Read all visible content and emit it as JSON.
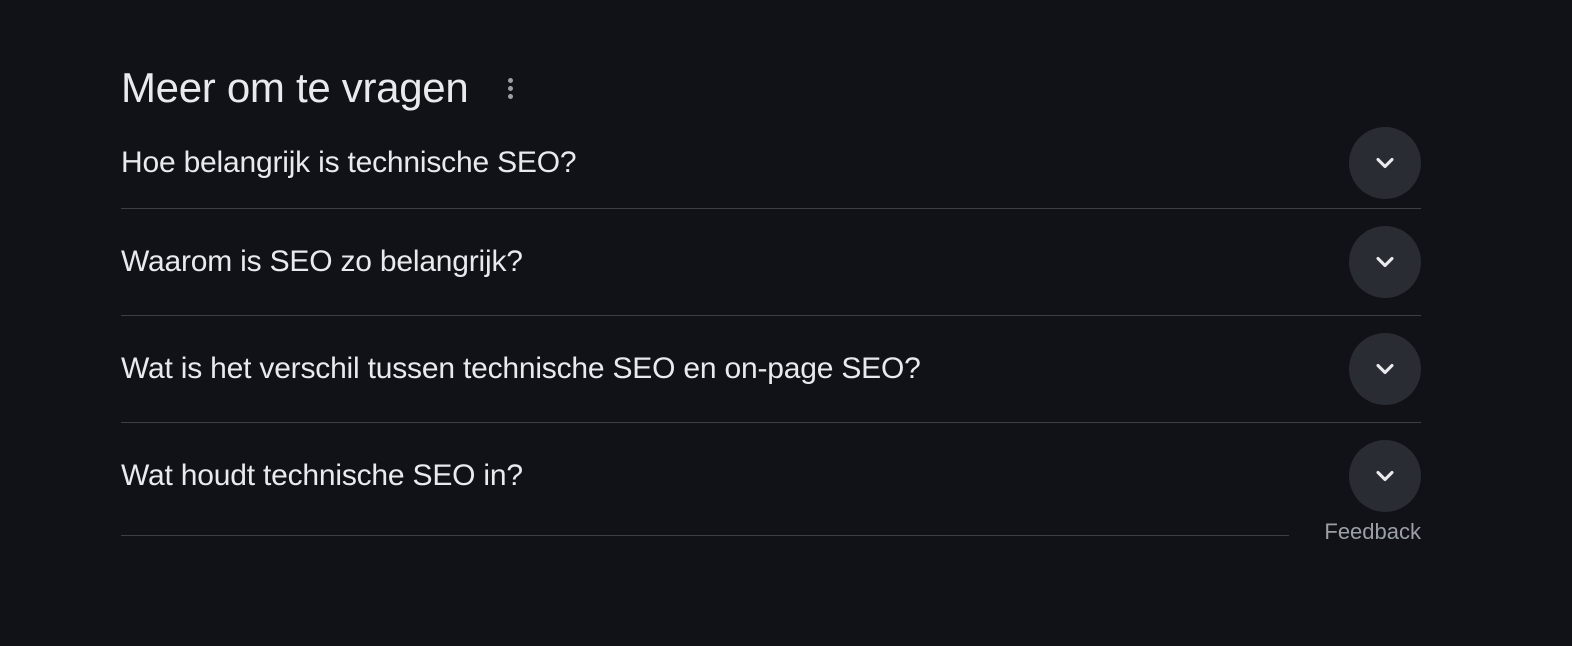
{
  "section": {
    "title": "Meer om te vragen",
    "more_icon": "more-vert-icon"
  },
  "questions": [
    {
      "text": "Hoe belangrijk is technische SEO?",
      "icon": "chevron-down-icon"
    },
    {
      "text": "Waarom is SEO zo belangrijk?",
      "icon": "chevron-down-icon"
    },
    {
      "text": "Wat is het verschil tussen technische SEO en on-page SEO?",
      "icon": "chevron-down-icon"
    },
    {
      "text": "Wat houdt technische SEO in?",
      "icon": "chevron-down-icon"
    }
  ],
  "footer": {
    "feedback_label": "Feedback"
  },
  "colors": {
    "background": "#101218",
    "text": "#e8eaed",
    "muted": "#9aa0a6",
    "divider": "#3c4043",
    "button_bg": "#2a2c33"
  }
}
